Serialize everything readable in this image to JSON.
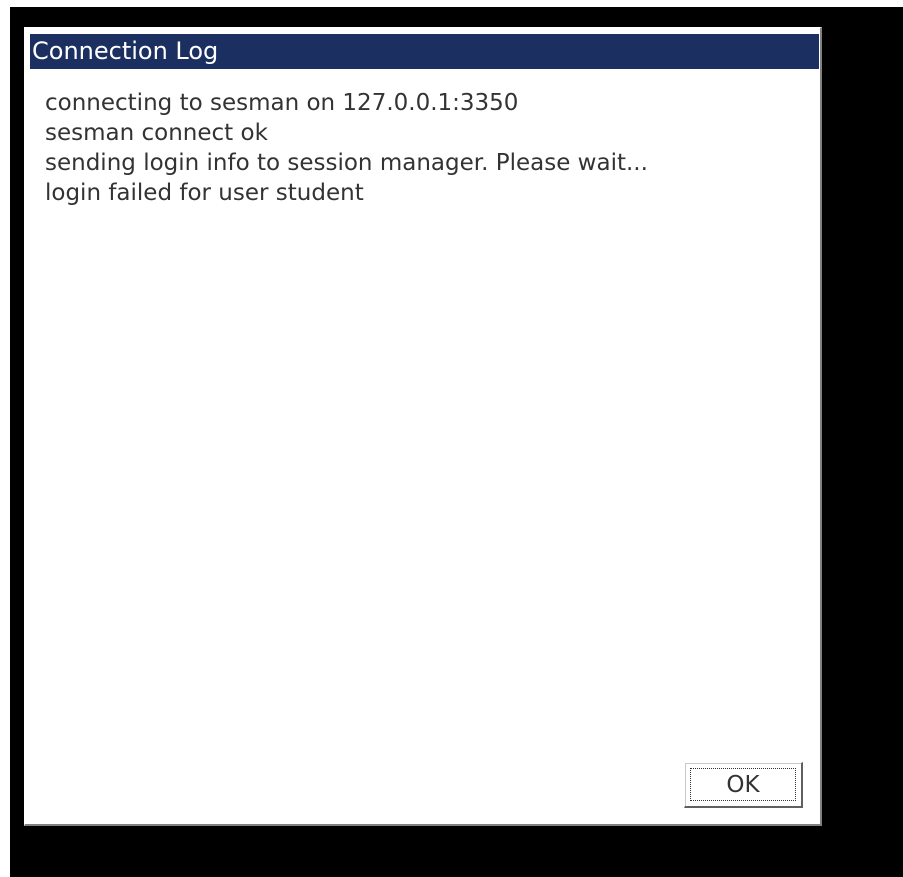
{
  "dialog": {
    "title": "Connection Log",
    "log_lines": [
      "connecting to sesman on 127.0.0.1:3350",
      "sesman connect ok",
      "sending login info to session manager. Please wait...",
      "login failed for user student"
    ],
    "ok_label": "OK"
  },
  "colors": {
    "titlebar": "#1b3060",
    "desktop": "#000000",
    "text": "#333333"
  }
}
